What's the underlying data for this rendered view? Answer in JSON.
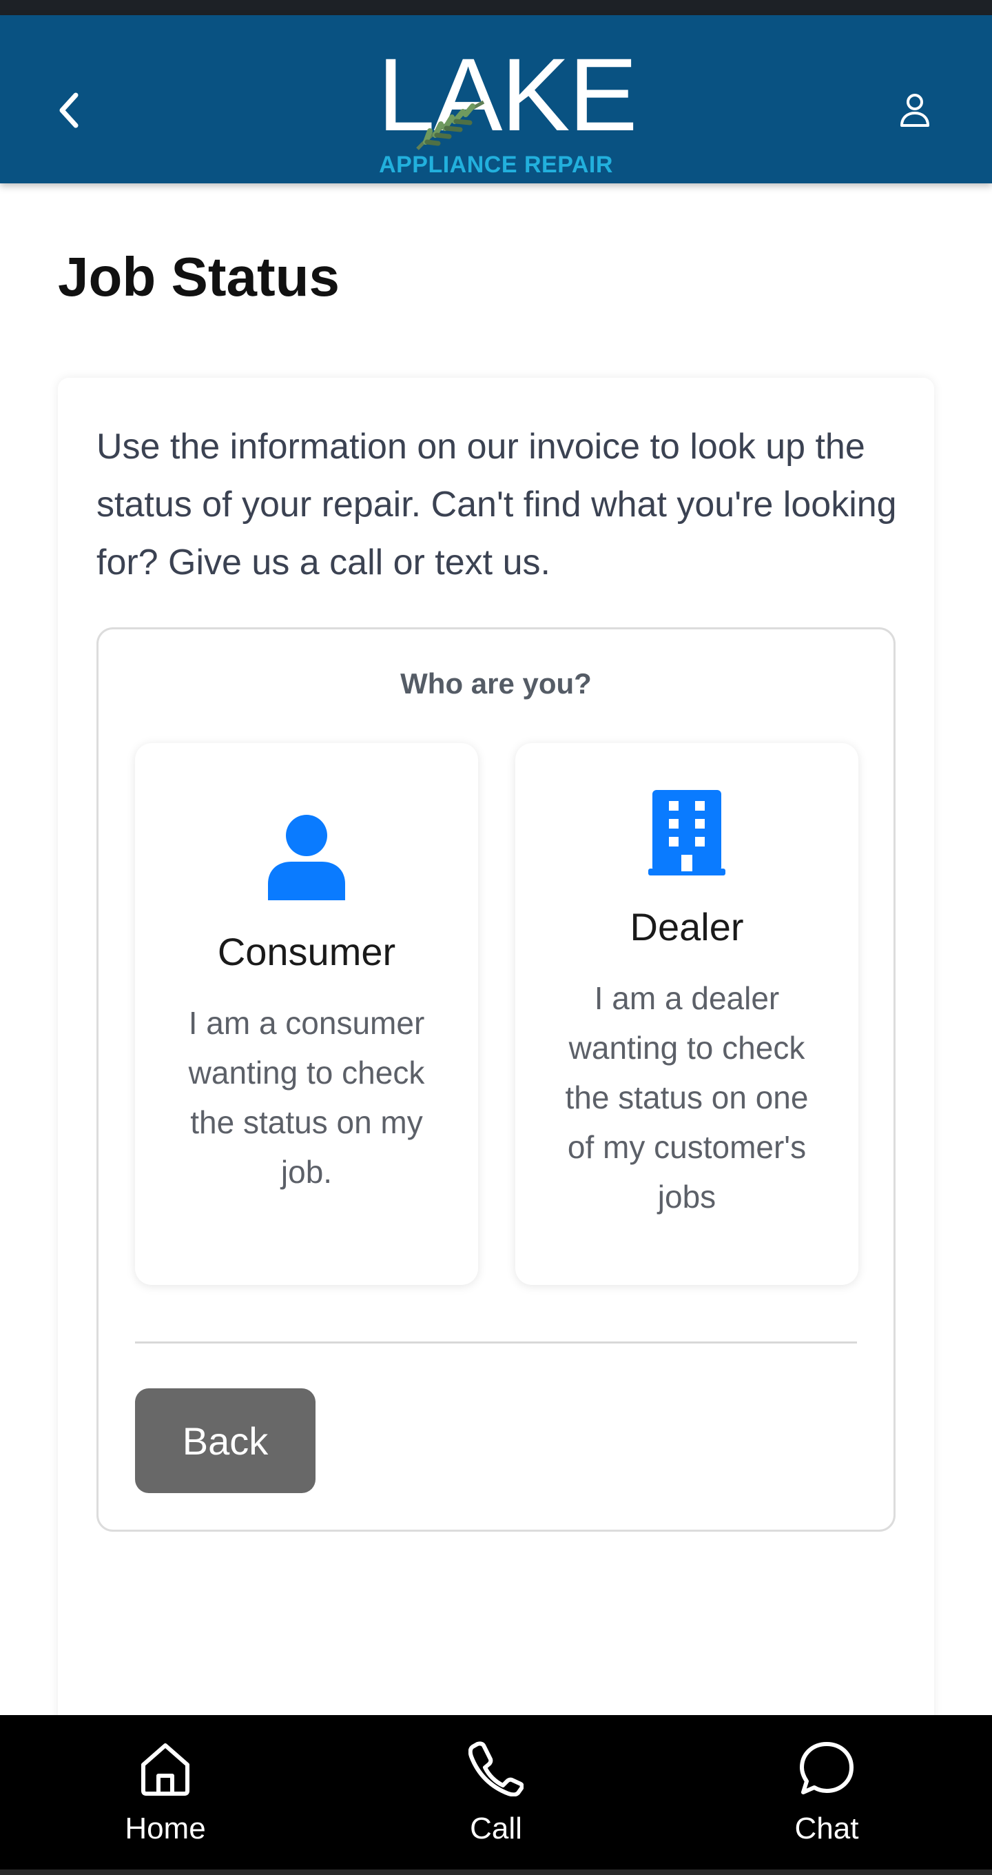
{
  "header": {
    "logo_word": "LAKE",
    "logo_sub": "APPLIANCE REPAIR",
    "back_icon": "chevron-left-icon",
    "account_icon": "user-icon",
    "colors": {
      "bar": "#095282",
      "logo_sub": "#22b0dd"
    }
  },
  "page": {
    "title": "Job Status",
    "intro": "Use the information on our invoice to look up the status of your repair. Can't find what you're looking for? Give us a call or text us."
  },
  "selector": {
    "question": "Who are you?",
    "options": [
      {
        "title": "Consumer",
        "description": "I am a consumer wanting to check the status on my job.",
        "icon": "person-icon"
      },
      {
        "title": "Dealer",
        "description": "I am a dealer wanting to check the status on one of my customer's jobs",
        "icon": "building-icon"
      }
    ],
    "back_label": "Back",
    "accent_color": "#0a7bff"
  },
  "bottom_nav": {
    "items": [
      {
        "label": "Home",
        "icon": "home-icon"
      },
      {
        "label": "Call",
        "icon": "phone-icon"
      },
      {
        "label": "Chat",
        "icon": "chat-bubble-icon"
      }
    ]
  }
}
